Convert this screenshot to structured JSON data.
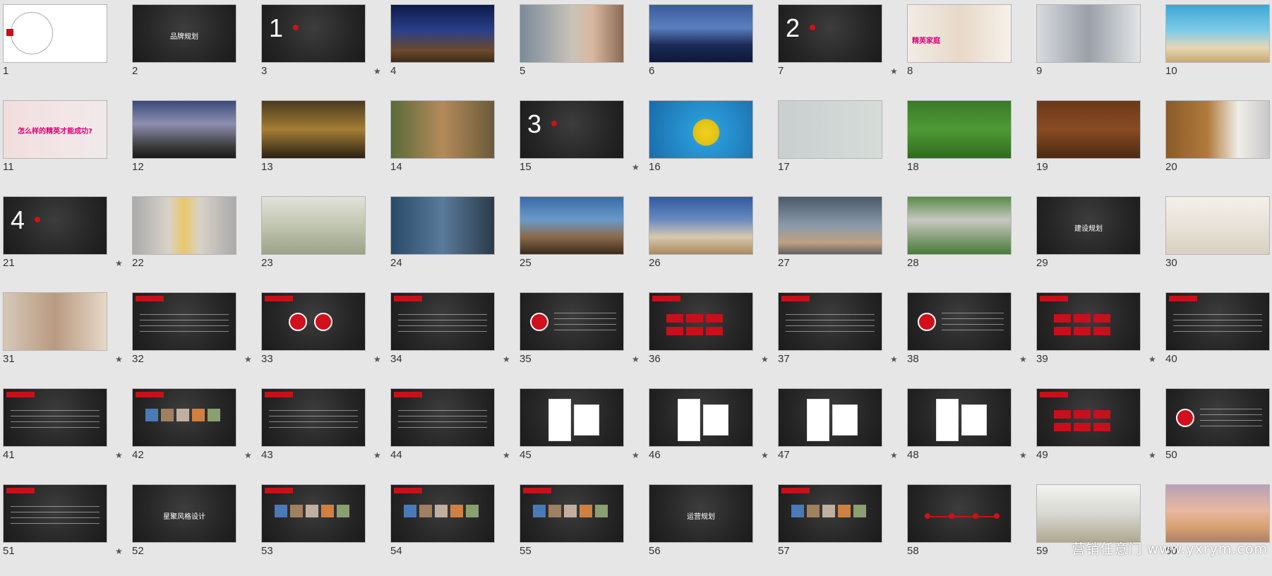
{
  "watermark": "营销任意门  www.yxrym.com",
  "slides": [
    {
      "num": "1",
      "star": false,
      "theme": "white",
      "label": ""
    },
    {
      "num": "2",
      "star": false,
      "theme": "dark",
      "label": "品牌规划"
    },
    {
      "num": "3",
      "star": true,
      "theme": "dark",
      "bignum": "1"
    },
    {
      "num": "4",
      "star": false,
      "theme": "photo-night",
      "label": ""
    },
    {
      "num": "5",
      "star": false,
      "theme": "photo-girl",
      "label": ""
    },
    {
      "num": "6",
      "star": false,
      "theme": "photo-mount",
      "label": ""
    },
    {
      "num": "7",
      "star": true,
      "theme": "dark",
      "bignum": "2"
    },
    {
      "num": "8",
      "star": false,
      "theme": "photo-family",
      "label": "精英家庭"
    },
    {
      "num": "9",
      "star": false,
      "theme": "photo-office",
      "label": ""
    },
    {
      "num": "10",
      "star": false,
      "theme": "photo-beach",
      "label": ""
    },
    {
      "num": "11",
      "star": false,
      "theme": "photo-hand",
      "label": "怎么样的精英才能成功?"
    },
    {
      "num": "12",
      "star": false,
      "theme": "photo-tree",
      "label": ""
    },
    {
      "num": "13",
      "star": false,
      "theme": "photo-room",
      "label": ""
    },
    {
      "num": "14",
      "star": false,
      "theme": "photo-people",
      "label": ""
    },
    {
      "num": "15",
      "star": true,
      "theme": "dark",
      "bignum": "3"
    },
    {
      "num": "16",
      "star": false,
      "theme": "photo-smile",
      "label": ""
    },
    {
      "num": "17",
      "star": false,
      "theme": "photo-map",
      "label": ""
    },
    {
      "num": "18",
      "star": false,
      "theme": "photo-grass",
      "label": ""
    },
    {
      "num": "19",
      "star": false,
      "theme": "photo-table",
      "label": ""
    },
    {
      "num": "20",
      "star": false,
      "theme": "photo-door",
      "label": ""
    },
    {
      "num": "21",
      "star": true,
      "theme": "dark",
      "bignum": "4"
    },
    {
      "num": "22",
      "star": false,
      "theme": "photo-face",
      "label": ""
    },
    {
      "num": "23",
      "star": false,
      "theme": "photo-money",
      "label": ""
    },
    {
      "num": "24",
      "star": false,
      "theme": "photo-man",
      "label": ""
    },
    {
      "num": "25",
      "star": false,
      "theme": "photo-pool",
      "label": ""
    },
    {
      "num": "26",
      "star": false,
      "theme": "photo-dinner",
      "label": ""
    },
    {
      "num": "27",
      "star": false,
      "theme": "photo-plane",
      "label": ""
    },
    {
      "num": "28",
      "star": false,
      "theme": "photo-aerial",
      "label": ""
    },
    {
      "num": "29",
      "star": false,
      "theme": "dark",
      "label": "建设规划"
    },
    {
      "num": "30",
      "star": true,
      "theme": "photo-suit",
      "label": ""
    },
    {
      "num": "31",
      "star": true,
      "theme": "photo-tea",
      "label": ""
    },
    {
      "num": "32",
      "star": true,
      "theme": "dark-text",
      "label": ""
    },
    {
      "num": "33",
      "star": true,
      "theme": "dark-circles",
      "label": ""
    },
    {
      "num": "34",
      "star": true,
      "theme": "dark-text",
      "label": ""
    },
    {
      "num": "35",
      "star": true,
      "theme": "dark-circle",
      "label": ""
    },
    {
      "num": "36",
      "star": true,
      "theme": "dark-boxes",
      "label": ""
    },
    {
      "num": "37",
      "star": true,
      "theme": "dark-text",
      "label": ""
    },
    {
      "num": "38",
      "star": true,
      "theme": "dark-circle",
      "label": ""
    },
    {
      "num": "39",
      "star": true,
      "theme": "dark-boxes",
      "label": ""
    },
    {
      "num": "40",
      "star": true,
      "theme": "dark-text",
      "label": ""
    },
    {
      "num": "41",
      "star": true,
      "theme": "dark-text",
      "label": ""
    },
    {
      "num": "42",
      "star": true,
      "theme": "dark-pics",
      "label": ""
    },
    {
      "num": "43",
      "star": true,
      "theme": "dark-text",
      "label": ""
    },
    {
      "num": "44",
      "star": true,
      "theme": "dark-text",
      "label": ""
    },
    {
      "num": "45",
      "star": true,
      "theme": "dark-screens",
      "label": ""
    },
    {
      "num": "46",
      "star": true,
      "theme": "dark-screens",
      "label": ""
    },
    {
      "num": "47",
      "star": true,
      "theme": "dark-screens",
      "label": ""
    },
    {
      "num": "48",
      "star": true,
      "theme": "dark-screens",
      "label": ""
    },
    {
      "num": "49",
      "star": true,
      "theme": "dark-boxes",
      "label": ""
    },
    {
      "num": "50",
      "star": true,
      "theme": "dark-circle",
      "label": ""
    },
    {
      "num": "51",
      "star": true,
      "theme": "dark-text",
      "label": ""
    },
    {
      "num": "52",
      "star": false,
      "theme": "dark",
      "label": "星聚风格设计"
    },
    {
      "num": "53",
      "star": false,
      "theme": "dark-pics",
      "label": ""
    },
    {
      "num": "54",
      "star": false,
      "theme": "dark-pics",
      "label": ""
    },
    {
      "num": "55",
      "star": false,
      "theme": "dark-pics",
      "label": ""
    },
    {
      "num": "56",
      "star": false,
      "theme": "dark",
      "label": "运营规划"
    },
    {
      "num": "57",
      "star": false,
      "theme": "dark-pics",
      "label": ""
    },
    {
      "num": "58",
      "star": false,
      "theme": "dark-line",
      "label": ""
    },
    {
      "num": "59",
      "star": false,
      "theme": "photo-meet",
      "label": ""
    },
    {
      "num": "60",
      "star": false,
      "theme": "photo-sunset",
      "label": ""
    }
  ]
}
